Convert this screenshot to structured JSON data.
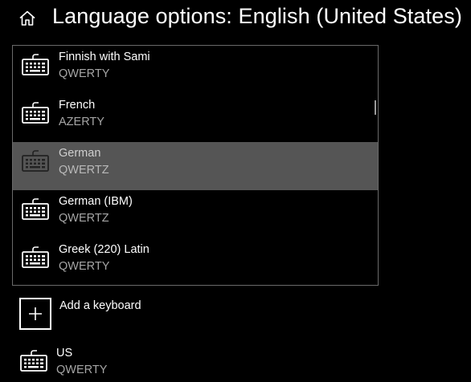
{
  "header": {
    "title": "Language options: English (United States)",
    "home_icon": "home-icon"
  },
  "keyboard_list": {
    "items": [
      {
        "name": "Finnish with Sami",
        "layout": "QWERTY",
        "icon": "keyboard-icon",
        "selected": false
      },
      {
        "name": "French",
        "layout": "AZERTY",
        "icon": "keyboard-icon",
        "selected": false
      },
      {
        "name": "German",
        "layout": "QWERTZ",
        "icon": "keyboard-icon",
        "selected": true
      },
      {
        "name": "German (IBM)",
        "layout": "QWERTZ",
        "icon": "keyboard-icon",
        "selected": false
      },
      {
        "name": "Greek (220) Latin",
        "layout": "QWERTY",
        "icon": "keyboard-icon",
        "selected": false
      }
    ]
  },
  "add_keyboard": {
    "label": "Add a keyboard",
    "icon": "plus-icon"
  },
  "installed_keyboard": {
    "name": "US",
    "layout": "QWERTY",
    "icon": "keyboard-icon"
  },
  "colors": {
    "background": "#000000",
    "selected_row": "#555555",
    "secondary_text": "#a6a6a6",
    "panel_border": "#6a6a6a"
  }
}
